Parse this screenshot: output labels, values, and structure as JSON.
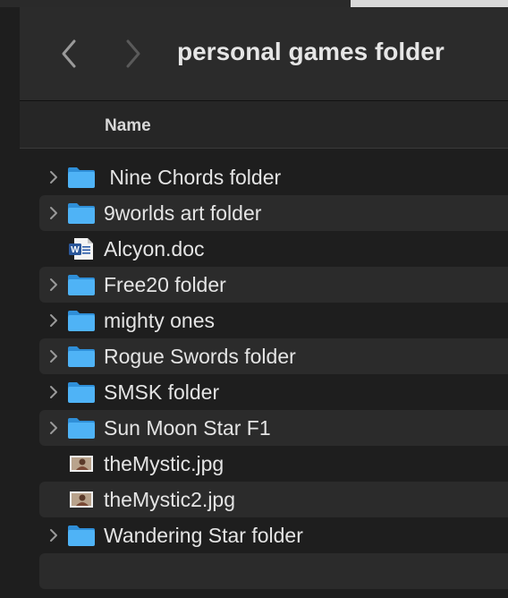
{
  "window": {
    "title": "personal games folder"
  },
  "columns": {
    "name": "Name"
  },
  "files": [
    {
      "label": " Nine Chords folder",
      "kind": "folder",
      "icon": "folder-icon"
    },
    {
      "label": "9worlds art folder",
      "kind": "folder",
      "icon": "folder-icon"
    },
    {
      "label": "Alcyon.doc",
      "kind": "doc",
      "icon": "word-document-icon"
    },
    {
      "label": "Free20 folder",
      "kind": "folder",
      "icon": "folder-icon"
    },
    {
      "label": "mighty ones",
      "kind": "folder",
      "icon": "folder-icon"
    },
    {
      "label": "Rogue Swords folder",
      "kind": "folder",
      "icon": "folder-icon"
    },
    {
      "label": "SMSK folder",
      "kind": "folder",
      "icon": "folder-icon"
    },
    {
      "label": "Sun Moon Star F1",
      "kind": "folder",
      "icon": "folder-icon"
    },
    {
      "label": "theMystic.jpg",
      "kind": "image",
      "icon": "image-thumbnail-icon"
    },
    {
      "label": "theMystic2.jpg",
      "kind": "image",
      "icon": "image-thumbnail-icon"
    },
    {
      "label": "Wandering Star folder",
      "kind": "folder",
      "icon": "folder-icon"
    }
  ],
  "colors": {
    "folder": "#4fb3f6",
    "background": "#1e1e1e",
    "alt_row": "#2b2b2b",
    "text": "#e4e4e4"
  }
}
